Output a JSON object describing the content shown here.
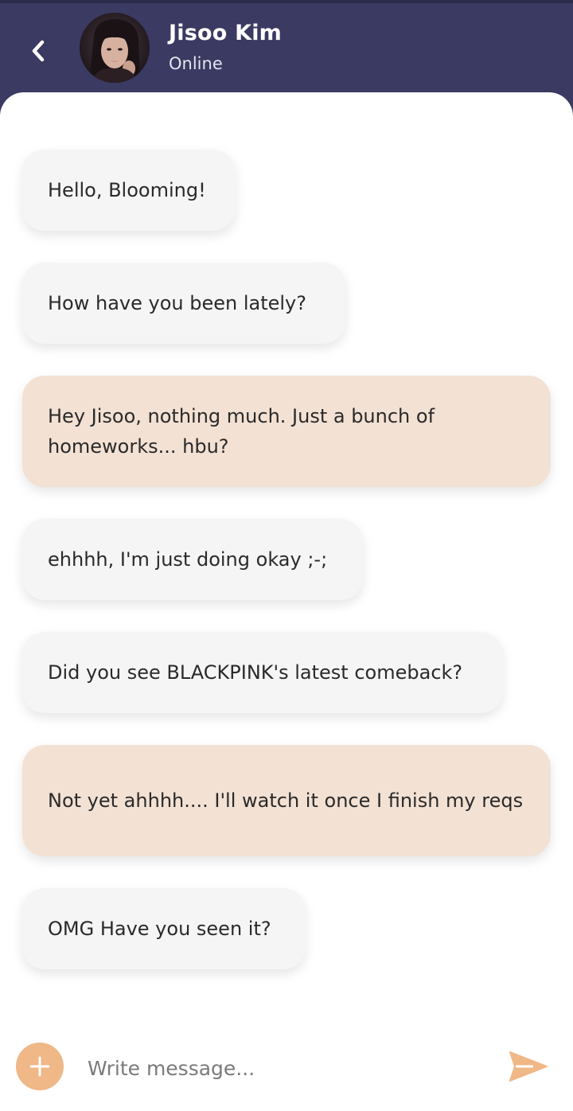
{
  "header": {
    "back_icon": "chevron-left-icon",
    "contact_name": "Jisoo Kim",
    "contact_status": "Online"
  },
  "messages": [
    {
      "direction": "received",
      "text": "Hello, Blooming!"
    },
    {
      "direction": "received",
      "text": "How have you been lately?"
    },
    {
      "direction": "sent",
      "text": "Hey Jisoo, nothing much. Just a bunch of homeworks... hbu?"
    },
    {
      "direction": "received",
      "text": "ehhhh, I'm just doing okay ;-;"
    },
    {
      "direction": "received",
      "text": "Did you see BLACKPINK's latest comeback?"
    },
    {
      "direction": "sent",
      "text": "Not yet ahhhh.... I'll watch it once I finish my reqs"
    },
    {
      "direction": "received",
      "text": "OMG Have you seen it?"
    }
  ],
  "composer": {
    "placeholder": "Write message...",
    "value": "",
    "add_icon": "plus-icon",
    "send_icon": "send-icon"
  },
  "colors": {
    "header_bg": "#3a3a62",
    "received_bubble": "#f5f5f5",
    "sent_bubble": "#f3e1d3",
    "accent": "#f0b787"
  }
}
